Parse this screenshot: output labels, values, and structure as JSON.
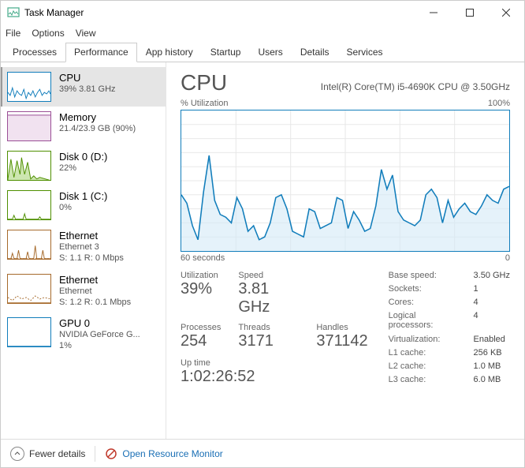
{
  "window": {
    "title": "Task Manager"
  },
  "menu": {
    "file": "File",
    "options": "Options",
    "view": "View"
  },
  "tabs": {
    "processes": "Processes",
    "performance": "Performance",
    "app_history": "App history",
    "startup": "Startup",
    "users": "Users",
    "details": "Details",
    "services": "Services"
  },
  "sidebar": {
    "cpu": {
      "title": "CPU",
      "sub1": "39% 3.81 GHz",
      "sub2": ""
    },
    "memory": {
      "title": "Memory",
      "sub1": "21.4/23.9 GB (90%)",
      "sub2": ""
    },
    "disk0": {
      "title": "Disk 0 (D:)",
      "sub1": "22%",
      "sub2": ""
    },
    "disk1": {
      "title": "Disk 1 (C:)",
      "sub1": "0%",
      "sub2": ""
    },
    "eth0": {
      "title": "Ethernet",
      "sub1": "Ethernet 3",
      "sub2": "S: 1.1 R: 0 Mbps"
    },
    "eth1": {
      "title": "Ethernet",
      "sub1": "Ethernet",
      "sub2": "S: 1.2 R: 0.1 Mbps"
    },
    "gpu0": {
      "title": "GPU 0",
      "sub1": "NVIDIA GeForce G...",
      "sub2": "1%"
    }
  },
  "main": {
    "heading": "CPU",
    "sub": "Intel(R) Core(TM) i5-4690K CPU @ 3.50GHz",
    "chart_label_left": "% Utilization",
    "chart_label_right": "100%",
    "chart_footer_left": "60 seconds",
    "chart_footer_right": "0",
    "stats": {
      "utilization_label": "Utilization",
      "utilization": "39%",
      "speed_label": "Speed",
      "speed": "3.81 GHz",
      "processes_label": "Processes",
      "processes": "254",
      "threads_label": "Threads",
      "threads": "3171",
      "handles_label": "Handles",
      "handles": "371142",
      "uptime_label": "Up time",
      "uptime": "1:02:26:52"
    },
    "info": {
      "base_speed_k": "Base speed:",
      "base_speed_v": "3.50 GHz",
      "sockets_k": "Sockets:",
      "sockets_v": "1",
      "cores_k": "Cores:",
      "cores_v": "4",
      "logical_k": "Logical processors:",
      "logical_v": "4",
      "virt_k": "Virtualization:",
      "virt_v": "Enabled",
      "l1_k": "L1 cache:",
      "l1_v": "256 KB",
      "l2_k": "L2 cache:",
      "l2_v": "1.0 MB",
      "l3_k": "L3 cache:",
      "l3_v": "6.0 MB"
    }
  },
  "footer": {
    "fewer_details": "Fewer details",
    "open_resource_monitor": "Open Resource Monitor"
  },
  "chart_data": {
    "type": "line",
    "title": "% Utilization",
    "xlabel": "60 seconds",
    "ylabel": "% Utilization",
    "ylim": [
      0,
      100
    ],
    "x": [
      0,
      1,
      2,
      3,
      4,
      5,
      6,
      7,
      8,
      9,
      10,
      11,
      12,
      13,
      14,
      15,
      16,
      17,
      18,
      19,
      20,
      21,
      22,
      23,
      24,
      25,
      26,
      27,
      28,
      29,
      30,
      31,
      32,
      33,
      34,
      35,
      36,
      37,
      38,
      39,
      40,
      41,
      42,
      43,
      44,
      45,
      46,
      47,
      48,
      49,
      50,
      51,
      52,
      53,
      54,
      55,
      56,
      57,
      58,
      59
    ],
    "values": [
      40,
      34,
      18,
      8,
      42,
      68,
      36,
      26,
      24,
      20,
      38,
      30,
      14,
      18,
      8,
      10,
      20,
      38,
      40,
      30,
      14,
      12,
      10,
      30,
      28,
      16,
      18,
      20,
      38,
      36,
      16,
      28,
      22,
      14,
      16,
      32,
      58,
      44,
      54,
      28,
      22,
      20,
      18,
      22,
      40,
      44,
      38,
      20,
      36,
      24,
      30,
      34,
      28,
      26,
      32,
      40,
      36,
      34,
      44,
      46
    ]
  },
  "colors": {
    "cpu": "#117dbb",
    "memory": "#9b4f96",
    "disk": "#4f8f00",
    "ethernet": "#a66a2c",
    "gpu": "#117dbb"
  }
}
